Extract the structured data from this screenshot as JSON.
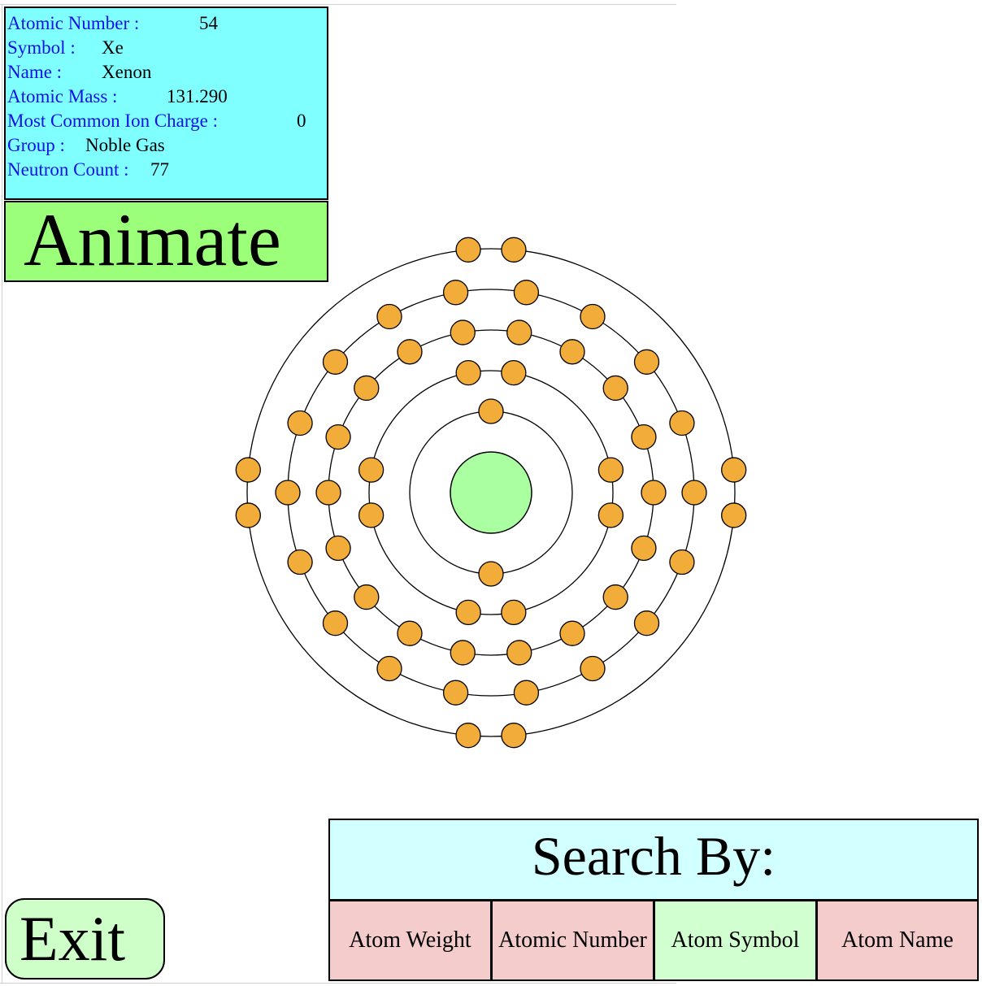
{
  "info": {
    "atomic_number_label": "Atomic Number :",
    "atomic_number_value": "54",
    "symbol_label": "Symbol :",
    "symbol_value": "Xe",
    "name_label": "Name :",
    "name_value": "Xenon",
    "atomic_mass_label": "Atomic Mass :",
    "atomic_mass_value": "131.290",
    "ion_charge_label": "Most Common Ion Charge :",
    "ion_charge_value": "0",
    "group_label": "Group :",
    "group_value": "Noble Gas",
    "neutron_label": "Neutron Count :",
    "neutron_value": "77"
  },
  "animate_label": "Animate",
  "exit_label": "Exit",
  "search": {
    "title": "Search By:",
    "options": [
      "Atom Weight",
      "Atomic Number",
      "Atom Symbol",
      "Atom Name"
    ],
    "selected": "Atom Symbol"
  },
  "atom": {
    "shells": [
      2,
      8,
      18,
      18,
      8
    ],
    "nucleus_color": "#aaffa0",
    "electron_color": "#f1ac3a"
  }
}
